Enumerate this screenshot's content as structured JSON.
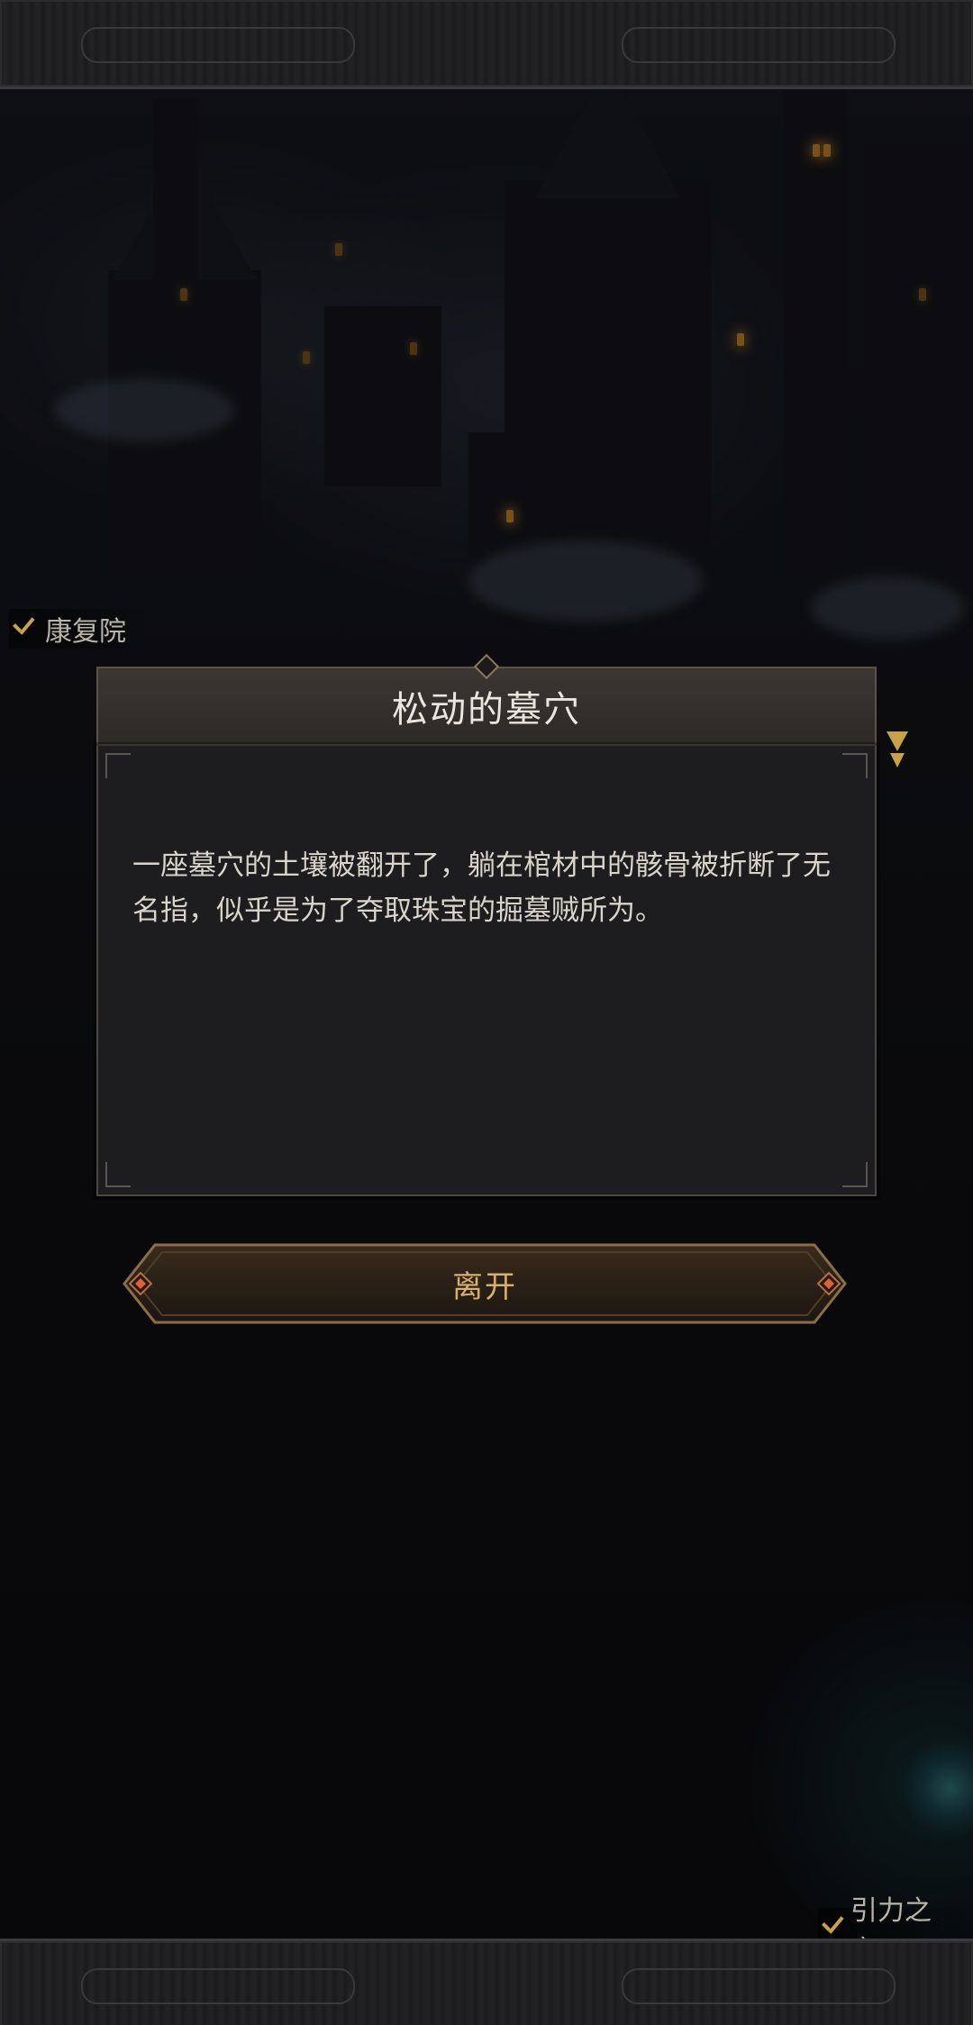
{
  "map": {
    "location_top": "康复院",
    "location_bottom": "引力之穴"
  },
  "dialog": {
    "title": "松动的墓穴",
    "body": "一座墓穴的土壤被翻开了，躺在棺材中的骸骨被折断了无名指，似乎是为了夺取珠宝的掘墓贼所为。"
  },
  "actions": {
    "leave_label": "离开"
  },
  "icons": {
    "map_marker_check": "check-icon",
    "map_marker_gem": "gem-icon",
    "button_left_gem": "diamond-icon",
    "button_right_gem": "diamond-icon"
  },
  "colors": {
    "title_text": "#eae6de",
    "body_text": "#d9d5cd",
    "button_text": "#d8b06a",
    "check": "#c8a24a",
    "window_light": "#d8952f"
  }
}
